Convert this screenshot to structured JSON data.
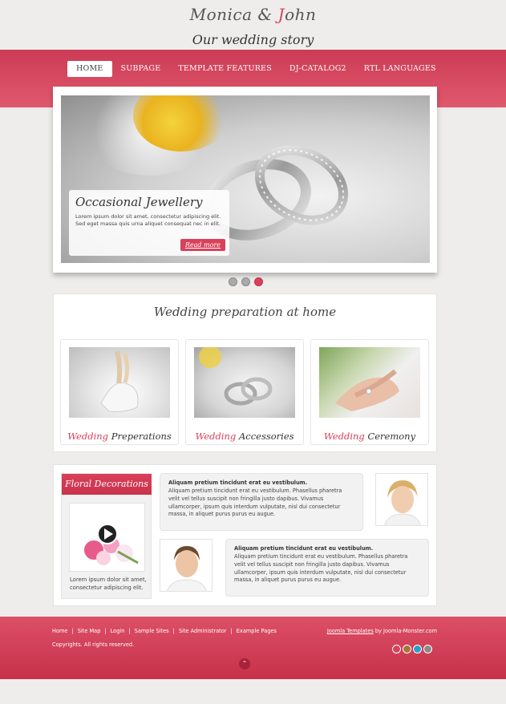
{
  "brand": {
    "title_a": "Monica",
    "title_amp": "&",
    "title_b": "John",
    "subtitle": "Our wedding story"
  },
  "nav": [
    {
      "label": "HOME",
      "active": true
    },
    {
      "label": "SUBPAGE"
    },
    {
      "label": "TEMPLATE FEATURES"
    },
    {
      "label": "DJ-CATALOG2"
    },
    {
      "label": "RTL LANGUAGES"
    }
  ],
  "slider": {
    "title": "Occasional Jewellery",
    "text": "Lorem ipsum dolor sit amet, consectetur adipiscing elit. Sed eget massa quis urna aliquet consequat nec in elit.",
    "button": "Read more"
  },
  "dots": 3,
  "prep": {
    "title": "Wedding preparation at home",
    "cards": [
      {
        "accent": "Wedding",
        "rest": "Preperations"
      },
      {
        "accent": "Wedding",
        "rest": "Accessories"
      },
      {
        "accent": "Wedding",
        "rest": "Ceremony"
      }
    ]
  },
  "floral": {
    "title": "Floral Decorations",
    "text": "Lorem ipsum dolor sit amet, consectetur adipiscing elit."
  },
  "testimonials": [
    {
      "title": "Aliquam pretium tincidunt erat eu vestibulum.",
      "text": "Aliquam pretium tincidunt erat eu vestibulum. Phasellus pharetra velit vel tellus suscipit non fringilla justo dapibus. Vivamus ullamcorper, ipsum quis interdum vulputate, nisl dui consectetur massa, in aliquet purus purus eu augue."
    },
    {
      "title": "Aliquam pretium tincidunt erat eu vestibulum.",
      "text": "Aliquam pretium tincidunt erat eu vestibulum. Phasellus pharetra velit vel tellus suscipit non fringilla justo dapibus. Vivamus ullamcorper, ipsum quis interdum vulputate, nisl dui consectetur massa, in aliquet purus purus eu augue."
    }
  ],
  "footer": {
    "links": [
      "Home",
      "Site Map",
      "Login",
      "Sample Sites",
      "Site Administrator",
      "Example Pages"
    ],
    "copyright": "Copyrights. All rights reserved.",
    "credit_link": "Joomla Templates",
    "credit_text": " by Joomla-Monster.com",
    "swatches": [
      "#d9405a",
      "#a0783c",
      "#2aa0c8",
      "#8a8a8a"
    ],
    "totop_icon": "double-chevron-up-icon"
  },
  "colors": {
    "accent": "#d9405a",
    "band": "#cc3b55"
  }
}
